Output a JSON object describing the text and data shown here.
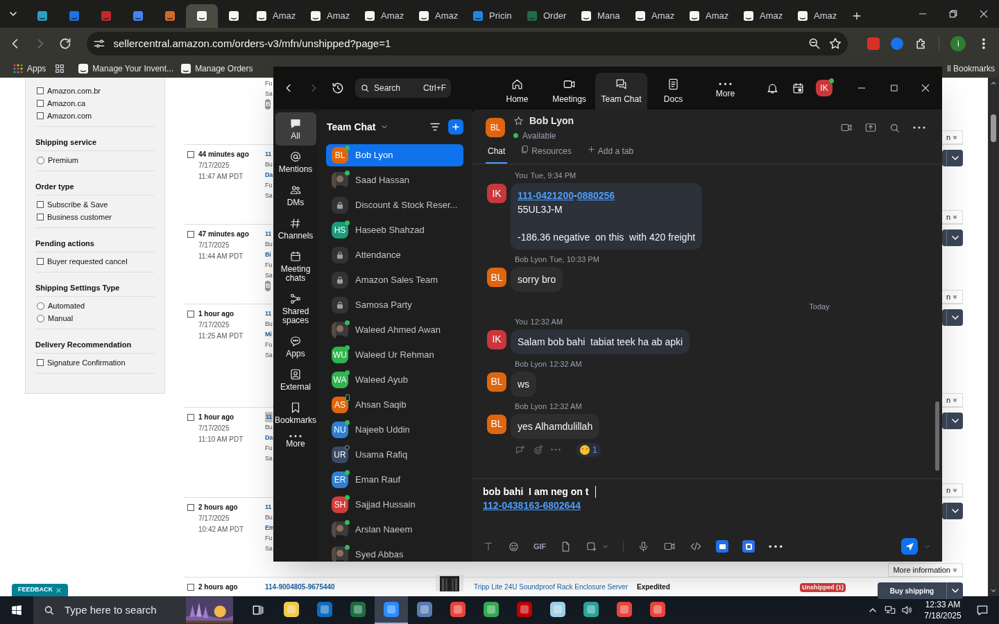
{
  "browser": {
    "tabs": [
      {
        "color": "#2b9fc4",
        "selected": false
      },
      {
        "color": "#1a73e8",
        "selected": false
      },
      {
        "color": "#c62828",
        "selected": false
      },
      {
        "color": "#4285f4",
        "selected": false
      },
      {
        "color": "#d9662a",
        "selected": false
      },
      {
        "color": "#f5f5f5",
        "selected": true
      },
      {
        "color": "#f5f5f5",
        "selected": false
      },
      {
        "label": "Amaz",
        "color": "#f5f5f5",
        "selected": false
      },
      {
        "label": "Amaz",
        "color": "#f5f5f5",
        "selected": false
      },
      {
        "label": "Amaz",
        "color": "#f5f5f5",
        "selected": false
      },
      {
        "label": "Amaz",
        "color": "#f5f5f5",
        "selected": false
      },
      {
        "label": "Pricin",
        "color": "#1e88e5",
        "selected": false
      },
      {
        "label": "Order",
        "color": "#1d6f42",
        "selected": false
      },
      {
        "label": "Mana",
        "color": "#f5f5f5",
        "selected": false
      },
      {
        "label": "Amaz",
        "color": "#f5f5f5",
        "selected": false
      },
      {
        "label": "Amaz",
        "color": "#f5f5f5",
        "selected": false
      },
      {
        "label": "Amaz",
        "color": "#f5f5f5",
        "selected": false
      },
      {
        "label": "Amaz",
        "color": "#f5f5f5",
        "selected": false
      }
    ],
    "address": "sellercentral.amazon.com/orders-v3/mfn/unshipped?page=1",
    "profile_initial": "i",
    "bookmarks": [
      {
        "label": "Apps"
      },
      {
        "label": "Manage Your Invent..."
      },
      {
        "label": "Manage Orders"
      }
    ],
    "all_bookmarks": "ll Bookmarks"
  },
  "page": {
    "filters": [
      {
        "options": [
          {
            "label": "Amazon.com.br",
            "kind": "checkbox",
            "checked": false
          },
          {
            "label": "Amazon.ca",
            "kind": "checkbox",
            "checked": false
          },
          {
            "label": "Amazon.com",
            "kind": "checkbox",
            "checked": false
          }
        ]
      },
      {
        "title": "Shipping service",
        "options": [
          {
            "label": "Premium",
            "kind": "radio",
            "checked": false
          }
        ]
      },
      {
        "title": "Order type",
        "options": [
          {
            "label": "Subscribe & Save",
            "kind": "checkbox",
            "checked": false
          },
          {
            "label": "Business customer",
            "kind": "checkbox",
            "checked": false
          }
        ]
      },
      {
        "title": "Pending actions",
        "options": [
          {
            "label": "Buyer requested cancel",
            "kind": "checkbox",
            "checked": false
          }
        ]
      },
      {
        "title": "Shipping Settings Type",
        "options": [
          {
            "label": "Automated",
            "kind": "radio",
            "checked": false
          },
          {
            "label": "Manual",
            "kind": "radio",
            "checked": false
          }
        ]
      },
      {
        "title": "Delivery Recommendation",
        "options": [
          {
            "label": "Signature Confirmation",
            "kind": "checkbox",
            "checked": false
          }
        ]
      }
    ],
    "orders": [
      {
        "column_2": [
          {
            "text": "Fu",
            "kind": "text"
          },
          {
            "text": "Sa",
            "kind": "text"
          },
          {
            "text": "B",
            "kind": "badge"
          }
        ]
      },
      {
        "action": "n",
        "age": "44 minutes ago",
        "date": "7/17/2025",
        "time": "11:47 AM PDT",
        "checked": false,
        "column_2": [
          {
            "text": "11",
            "kind": "link"
          },
          {
            "text": "Bu",
            "kind": "text"
          },
          {
            "text": "Da",
            "kind": "link"
          },
          {
            "text": "Fu",
            "kind": "text"
          },
          {
            "text": "Sa",
            "kind": "text"
          }
        ]
      },
      {
        "action": "n",
        "age": "47 minutes ago",
        "date": "7/17/2025",
        "time": "11:44 AM PDT",
        "checked": false,
        "column_2": [
          {
            "text": "11",
            "kind": "link"
          },
          {
            "text": "Bu",
            "kind": "text"
          },
          {
            "text": "Bi",
            "kind": "link"
          },
          {
            "text": "Fu",
            "kind": "text"
          },
          {
            "text": "Sa",
            "kind": "text"
          },
          {
            "text": "B",
            "kind": "badge"
          }
        ]
      },
      {
        "action": "n",
        "age": "1 hour ago",
        "date": "7/17/2025",
        "time": "11:25 AM PDT",
        "checked": false,
        "column_2": [
          {
            "text": "11",
            "kind": "link"
          },
          {
            "text": "Bu",
            "kind": "text"
          },
          {
            "text": "Mi",
            "kind": "link"
          },
          {
            "text": "Fu",
            "kind": "text"
          },
          {
            "text": "Sa",
            "kind": "text"
          }
        ]
      },
      {
        "action": "n",
        "age": "1 hour ago",
        "date": "7/17/2025",
        "time": "11:10 AM PDT",
        "checked": false,
        "column_2": [
          {
            "text": "11",
            "kind": "highlight"
          },
          {
            "text": "Bu",
            "kind": "text"
          },
          {
            "text": "Da",
            "kind": "link"
          },
          {
            "text": "Fu",
            "kind": "text"
          },
          {
            "text": "Sa",
            "kind": "text"
          }
        ]
      },
      {
        "action": "n",
        "age": "2 hours ago",
        "date": "7/17/2025",
        "time": "10:42 AM PDT",
        "checked": false,
        "column_2": [
          {
            "text": "11",
            "kind": "link"
          },
          {
            "text": "Bu",
            "kind": "text"
          },
          {
            "text": "Em",
            "kind": "link"
          },
          {
            "text": "Fu",
            "kind": "text"
          },
          {
            "text": "Sa",
            "kind": "text"
          }
        ]
      },
      {
        "action": "More information",
        "age": "2 hours ago",
        "checked": false,
        "order_id": "114-9004805-9675440",
        "product": "Tripp Lite 24U Soundproof Rack Enclosure Server",
        "shipping": "Expedited",
        "status": "Unshipped (1)",
        "button": "Buy shipping"
      }
    ],
    "feedback": "FEEDBACK"
  },
  "zoom": {
    "search": {
      "placeholder": "Search",
      "shortcut": "Ctrl+F"
    },
    "nav": [
      {
        "label": "Home",
        "kind": "home",
        "selected": false
      },
      {
        "label": "Meetings",
        "kind": "meetings",
        "selected": false
      },
      {
        "label": "Team Chat",
        "kind": "chat",
        "selected": true
      },
      {
        "label": "Docs",
        "kind": "docs",
        "selected": false
      },
      {
        "label": "More",
        "kind": "more",
        "selected": false
      }
    ],
    "user": {
      "initials": "IK",
      "color": "#c8373b"
    },
    "rail": [
      {
        "label": "All",
        "kind": "all",
        "selected": true
      },
      {
        "label": "Mentions",
        "kind": "mentions",
        "selected": false
      },
      {
        "label": "DMs",
        "kind": "dms",
        "selected": false
      },
      {
        "label": "Channels",
        "kind": "channels",
        "selected": false
      },
      {
        "label": "Meeting chats",
        "kind": "meetings",
        "selected": false
      },
      {
        "label": "Shared spaces",
        "kind": "spaces",
        "selected": false
      },
      {
        "label": "Apps",
        "kind": "apps",
        "selected": false
      },
      {
        "label": "External",
        "kind": "external",
        "selected": false
      },
      {
        "label": "Bookmarks",
        "kind": "bookmarks",
        "selected": false
      },
      {
        "label": "More",
        "kind": "more",
        "selected": false
      }
    ],
    "list_title": "Team Chat",
    "contacts": [
      {
        "name": "Bob Lyon",
        "kind": "initials",
        "initials": "BL",
        "color": "#e0650f",
        "online": true,
        "mobile": false,
        "selected": true
      },
      {
        "name": "Saad Hassan",
        "online": true,
        "mobile": false,
        "selected": false
      },
      {
        "name": "Discount & Stock Reser...",
        "kind": "lock",
        "selected": false
      },
      {
        "name": "Haseeb Shahzad",
        "kind": "initials",
        "initials": "HS",
        "color": "#1a9c7a",
        "online": true,
        "mobile": false,
        "selected": false
      },
      {
        "name": "Attendance",
        "kind": "lock",
        "selected": false
      },
      {
        "name": "Amazon Sales Team",
        "kind": "lock",
        "selected": false
      },
      {
        "name": "Samosa Party",
        "kind": "lock",
        "selected": false
      },
      {
        "name": "Waleed Ahmed Awan",
        "online": true,
        "mobile": false,
        "selected": false
      },
      {
        "name": "Waleed Ur Rehman",
        "kind": "initials",
        "initials": "WU",
        "color": "#2fb44f",
        "online": true,
        "mobile": false,
        "selected": false
      },
      {
        "name": "Waleed Ayub",
        "kind": "initials",
        "initials": "WA",
        "color": "#2fb44f",
        "online": true,
        "mobile": false,
        "selected": false
      },
      {
        "name": "Ahsan Saqib",
        "kind": "initials",
        "initials": "AS",
        "color": "#e0650f",
        "online": true,
        "mobile": true,
        "selected": false
      },
      {
        "name": "Najeeb Uddin",
        "kind": "initials",
        "initials": "NU",
        "color": "#2f7fd1",
        "online": true,
        "mobile": false,
        "selected": false
      },
      {
        "name": "Usama Rafiq",
        "kind": "initials",
        "initials": "UR",
        "color": "#3a4a66",
        "online": false,
        "mobile": false,
        "selected": false
      },
      {
        "name": "Eman Rauf",
        "kind": "initials",
        "initials": "ER",
        "color": "#2f7fd1",
        "online": true,
        "mobile": false,
        "selected": false
      },
      {
        "name": "Sajjad Hussain",
        "kind": "initials",
        "initials": "SH",
        "color": "#d43b3b",
        "online": true,
        "mobile": false,
        "selected": false
      },
      {
        "name": "Arslan Naeem",
        "online": true,
        "mobile": false,
        "selected": false
      },
      {
        "name": "Syed Abbas",
        "online": true,
        "mobile": false,
        "selected": false
      }
    ],
    "chat": {
      "name": "Bob Lyon",
      "initials": "BL",
      "color": "#e0650f",
      "status": "Available",
      "starred": false,
      "tabs": [
        {
          "label": "Chat",
          "kind": "chat",
          "selected": true
        },
        {
          "label": "Resources",
          "kind": "resources",
          "selected": false
        },
        {
          "label": "Add a tab",
          "kind": "add",
          "selected": false
        }
      ],
      "items": [
        {
          "kind": "message",
          "sender": "You",
          "time": "Tue, 9:34 PM",
          "initials": "IK",
          "color": "#c8373b",
          "mine": true,
          "lines": [
            {
              "segments": [
                {
                  "text": "111-0421200",
                  "kind": "link"
                },
                {
                  "text": "-",
                  "kind": "text"
                },
                {
                  "text": "0880256",
                  "kind": "link"
                }
              ]
            },
            {
              "segments": [
                {
                  "text": "55UL3J-M\n\n-186.36 negative  on this  with 420 freight",
                  "kind": "text"
                }
              ]
            }
          ]
        },
        {
          "kind": "message",
          "sender": "Bob Lyon",
          "time": "Tue, 10:33 PM",
          "initials": "BL",
          "color": "#e0650f",
          "mine": false,
          "lines": [
            {
              "segments": [
                {
                  "text": "sorry bro",
                  "kind": "text"
                }
              ]
            }
          ]
        },
        {
          "kind": "divider",
          "label": "Today"
        },
        {
          "kind": "message",
          "sender": "You",
          "time": "12:32 AM",
          "initials": "IK",
          "color": "#c8373b",
          "mine": true,
          "lines": [
            {
              "segments": [
                {
                  "text": "Salam bob bahi  tabiat teek ha ab apki",
                  "kind": "text"
                }
              ]
            }
          ]
        },
        {
          "kind": "message",
          "sender": "Bob Lyon",
          "time": "12:32 AM",
          "initials": "BL",
          "color": "#e0650f",
          "mine": false,
          "lines": [
            {
              "segments": [
                {
                  "text": "ws",
                  "kind": "text"
                }
              ]
            }
          ]
        },
        {
          "kind": "message",
          "sender": "Bob Lyon",
          "time": "12:32 AM",
          "initials": "BL",
          "color": "#e0650f",
          "mine": false,
          "lines": [
            {
              "segments": [
                {
                  "text": "yes Alhamdulillah",
                  "kind": "text"
                }
              ]
            }
          ],
          "reaction": {
            "count": "1"
          }
        }
      ]
    },
    "composer": {
      "draft": "bob bahi  I am neg on t",
      "draft_link": "112-0438163-6802644",
      "gif_label": "GIF"
    }
  },
  "taskbar": {
    "search": {
      "placeholder": "Type here to search"
    },
    "apps": [
      {
        "color": "#f2c94c",
        "selected": false
      },
      {
        "color": "#0f6cbd",
        "selected": false
      },
      {
        "color": "#1d6f42",
        "selected": false
      },
      {
        "color": "#2d8cff",
        "selected": true
      },
      {
        "color": "#5b7bb5",
        "selected": false
      },
      {
        "color": "#e8453c",
        "selected": false
      },
      {
        "color": "#34a853",
        "selected": false
      },
      {
        "color": "#bf0000",
        "selected": false
      },
      {
        "color": "#9fd0e6",
        "selected": false
      },
      {
        "color": "#2aa39a",
        "selected": false
      },
      {
        "color": "#e8453c",
        "selected": false
      },
      {
        "color": "#e8453c",
        "selected": false
      }
    ],
    "time": "12:33 AM",
    "date": "7/18/2025"
  }
}
